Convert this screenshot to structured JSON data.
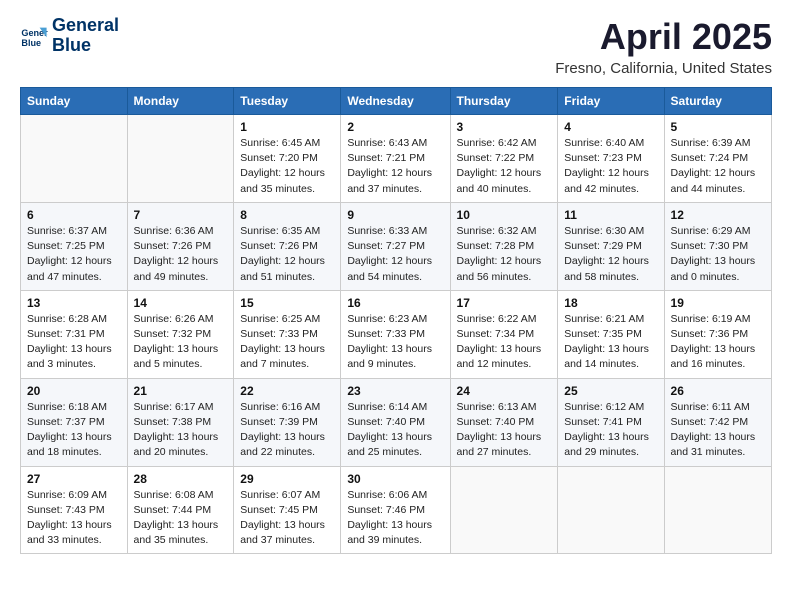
{
  "header": {
    "logo_line1": "General",
    "logo_line2": "Blue",
    "title": "April 2025",
    "subtitle": "Fresno, California, United States"
  },
  "days_of_week": [
    "Sunday",
    "Monday",
    "Tuesday",
    "Wednesday",
    "Thursday",
    "Friday",
    "Saturday"
  ],
  "weeks": [
    [
      {
        "day": "",
        "info": ""
      },
      {
        "day": "",
        "info": ""
      },
      {
        "day": "1",
        "info": "Sunrise: 6:45 AM\nSunset: 7:20 PM\nDaylight: 12 hours and 35 minutes."
      },
      {
        "day": "2",
        "info": "Sunrise: 6:43 AM\nSunset: 7:21 PM\nDaylight: 12 hours and 37 minutes."
      },
      {
        "day": "3",
        "info": "Sunrise: 6:42 AM\nSunset: 7:22 PM\nDaylight: 12 hours and 40 minutes."
      },
      {
        "day": "4",
        "info": "Sunrise: 6:40 AM\nSunset: 7:23 PM\nDaylight: 12 hours and 42 minutes."
      },
      {
        "day": "5",
        "info": "Sunrise: 6:39 AM\nSunset: 7:24 PM\nDaylight: 12 hours and 44 minutes."
      }
    ],
    [
      {
        "day": "6",
        "info": "Sunrise: 6:37 AM\nSunset: 7:25 PM\nDaylight: 12 hours and 47 minutes."
      },
      {
        "day": "7",
        "info": "Sunrise: 6:36 AM\nSunset: 7:26 PM\nDaylight: 12 hours and 49 minutes."
      },
      {
        "day": "8",
        "info": "Sunrise: 6:35 AM\nSunset: 7:26 PM\nDaylight: 12 hours and 51 minutes."
      },
      {
        "day": "9",
        "info": "Sunrise: 6:33 AM\nSunset: 7:27 PM\nDaylight: 12 hours and 54 minutes."
      },
      {
        "day": "10",
        "info": "Sunrise: 6:32 AM\nSunset: 7:28 PM\nDaylight: 12 hours and 56 minutes."
      },
      {
        "day": "11",
        "info": "Sunrise: 6:30 AM\nSunset: 7:29 PM\nDaylight: 12 hours and 58 minutes."
      },
      {
        "day": "12",
        "info": "Sunrise: 6:29 AM\nSunset: 7:30 PM\nDaylight: 13 hours and 0 minutes."
      }
    ],
    [
      {
        "day": "13",
        "info": "Sunrise: 6:28 AM\nSunset: 7:31 PM\nDaylight: 13 hours and 3 minutes."
      },
      {
        "day": "14",
        "info": "Sunrise: 6:26 AM\nSunset: 7:32 PM\nDaylight: 13 hours and 5 minutes."
      },
      {
        "day": "15",
        "info": "Sunrise: 6:25 AM\nSunset: 7:33 PM\nDaylight: 13 hours and 7 minutes."
      },
      {
        "day": "16",
        "info": "Sunrise: 6:23 AM\nSunset: 7:33 PM\nDaylight: 13 hours and 9 minutes."
      },
      {
        "day": "17",
        "info": "Sunrise: 6:22 AM\nSunset: 7:34 PM\nDaylight: 13 hours and 12 minutes."
      },
      {
        "day": "18",
        "info": "Sunrise: 6:21 AM\nSunset: 7:35 PM\nDaylight: 13 hours and 14 minutes."
      },
      {
        "day": "19",
        "info": "Sunrise: 6:19 AM\nSunset: 7:36 PM\nDaylight: 13 hours and 16 minutes."
      }
    ],
    [
      {
        "day": "20",
        "info": "Sunrise: 6:18 AM\nSunset: 7:37 PM\nDaylight: 13 hours and 18 minutes."
      },
      {
        "day": "21",
        "info": "Sunrise: 6:17 AM\nSunset: 7:38 PM\nDaylight: 13 hours and 20 minutes."
      },
      {
        "day": "22",
        "info": "Sunrise: 6:16 AM\nSunset: 7:39 PM\nDaylight: 13 hours and 22 minutes."
      },
      {
        "day": "23",
        "info": "Sunrise: 6:14 AM\nSunset: 7:40 PM\nDaylight: 13 hours and 25 minutes."
      },
      {
        "day": "24",
        "info": "Sunrise: 6:13 AM\nSunset: 7:40 PM\nDaylight: 13 hours and 27 minutes."
      },
      {
        "day": "25",
        "info": "Sunrise: 6:12 AM\nSunset: 7:41 PM\nDaylight: 13 hours and 29 minutes."
      },
      {
        "day": "26",
        "info": "Sunrise: 6:11 AM\nSunset: 7:42 PM\nDaylight: 13 hours and 31 minutes."
      }
    ],
    [
      {
        "day": "27",
        "info": "Sunrise: 6:09 AM\nSunset: 7:43 PM\nDaylight: 13 hours and 33 minutes."
      },
      {
        "day": "28",
        "info": "Sunrise: 6:08 AM\nSunset: 7:44 PM\nDaylight: 13 hours and 35 minutes."
      },
      {
        "day": "29",
        "info": "Sunrise: 6:07 AM\nSunset: 7:45 PM\nDaylight: 13 hours and 37 minutes."
      },
      {
        "day": "30",
        "info": "Sunrise: 6:06 AM\nSunset: 7:46 PM\nDaylight: 13 hours and 39 minutes."
      },
      {
        "day": "",
        "info": ""
      },
      {
        "day": "",
        "info": ""
      },
      {
        "day": "",
        "info": ""
      }
    ]
  ]
}
